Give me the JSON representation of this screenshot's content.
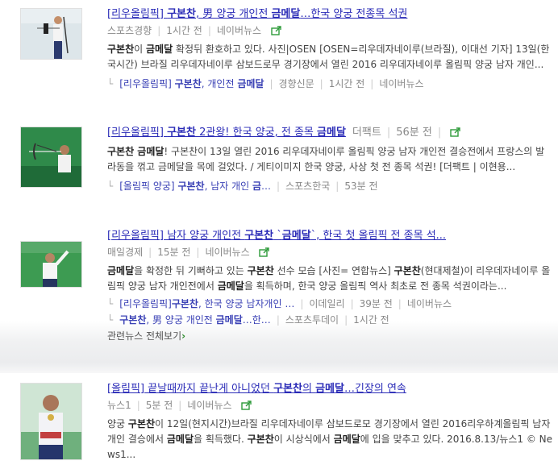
{
  "articles": [
    {
      "title_parts": [
        "[리우올림픽] ",
        "구본찬",
        ", 男 양궁 개인전 ",
        "금메달",
        "…한국 양궁 전종목 석권"
      ],
      "meta": [
        "스포츠경향",
        "1시간 전",
        "네이버뉴스"
      ],
      "desc_parts": [
        "구본찬",
        "이 ",
        "금메달",
        " 확정뒤 환호하고 있다. 사진|OSEN [OSEN=리우데자네이루(브라질), 이대선 기자] 13일(한국시간) 브라질 리우데자네이루 삼보드로무 경기장에서 열린 2016 리우데자네이루 올림픽 양궁 남자 개인..."
      ],
      "related": [
        {
          "parts": [
            "[리우올림픽] ",
            "구본찬",
            ", 개인전 ",
            "금메달"
          ],
          "source": "경향신문",
          "time": "1시간 전",
          "portal": "네이버뉴스"
        }
      ]
    },
    {
      "title_parts": [
        "[리우올림픽] ",
        "구본찬",
        " 2관왕! 한국 양궁, 전 종목 ",
        "금메달"
      ],
      "meta": [
        "더팩트",
        "56분 전"
      ],
      "desc_parts": [
        "구본찬 금메달",
        "! 구본찬이 13일 열린 2016 리우데자네이루 올림픽 양궁 남자 개인전 결승전에서 프랑스의 발라동을 꺾고 금메달을 목에 걸었다. / 게티이미지 한국 양궁, 사상 첫 전 종목 석권! [더팩트 | 이현용..."
      ],
      "related": [
        {
          "parts": [
            "[올림픽 양궁] ",
            "구본찬",
            ", 남자 개인 ",
            "금",
            "…"
          ],
          "source": "스포츠한국",
          "time": "53분 전",
          "portal": ""
        }
      ]
    },
    {
      "title_parts": [
        "[리우올림픽] 남자 양궁 개인전 ",
        "구본찬",
        " `",
        "금메달",
        "`, 한국 첫 올림픽 전 종목 석..."
      ],
      "meta": [
        "매일경제",
        "15분 전",
        "네이버뉴스"
      ],
      "desc_parts": [
        "금메달",
        "을 확정한 뒤 기뻐하고 있는 ",
        "구본찬",
        " 선수 모습 [사진= 연합뉴스] ",
        "구본찬",
        "(현대제철)이 리우데자네이루 올림픽 양궁 남자 개인전에서 ",
        "금메달",
        "을 획득하며, 한국 양궁 올림픽 역사 최초로 전 종목 석권이라는..."
      ],
      "related": [
        {
          "parts": [
            "[리우올림픽]",
            "구본찬",
            ", 한국 양궁 남자개인 …"
          ],
          "source": "이데일리",
          "time": "39분 전",
          "portal": "네이버뉴스"
        },
        {
          "parts": [
            "구본찬",
            ", 男 양궁 개인전 ",
            "금메달",
            "…한…"
          ],
          "source": "스포츠투데이",
          "time": "1시간 전",
          "portal": ""
        }
      ],
      "more_label": "관련뉴스 전체보기"
    },
    {
      "title_parts": [
        "[올림픽] 끝날때까지 끝난게 아니었던 ",
        "구본찬",
        "의 ",
        "금메달",
        "…긴장의 연속"
      ],
      "meta": [
        "뉴스1",
        "5분 전",
        "네이버뉴스"
      ],
      "desc_parts": [
        "양궁 ",
        "구본찬",
        "이 12일(현지시간)브라질 리우데자네이루 삼보드로모 경기장에서 열린 2016리우하계올림픽 남자 개인 결승에서 ",
        "금메달",
        "을 획득했다. ",
        "구본찬",
        "이 시상식에서 ",
        "금메달",
        "에 입을 맞추고 있다. 2016.8.13/뉴스1 © News1..."
      ]
    }
  ],
  "icons": {
    "share": "share-icon"
  },
  "colors": {
    "link": "#2a2bb7",
    "meta": "#888888",
    "share": "#2e9b3a"
  }
}
